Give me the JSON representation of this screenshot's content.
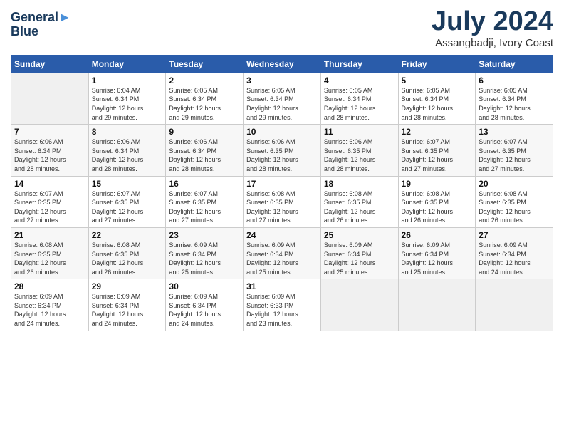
{
  "logo": {
    "line1": "General",
    "line2": "Blue"
  },
  "title": "July 2024",
  "subtitle": "Assangbadji, Ivory Coast",
  "days_of_week": [
    "Sunday",
    "Monday",
    "Tuesday",
    "Wednesday",
    "Thursday",
    "Friday",
    "Saturday"
  ],
  "weeks": [
    [
      {
        "num": "",
        "info": ""
      },
      {
        "num": "1",
        "info": "Sunrise: 6:04 AM\nSunset: 6:34 PM\nDaylight: 12 hours\nand 29 minutes."
      },
      {
        "num": "2",
        "info": "Sunrise: 6:05 AM\nSunset: 6:34 PM\nDaylight: 12 hours\nand 29 minutes."
      },
      {
        "num": "3",
        "info": "Sunrise: 6:05 AM\nSunset: 6:34 PM\nDaylight: 12 hours\nand 29 minutes."
      },
      {
        "num": "4",
        "info": "Sunrise: 6:05 AM\nSunset: 6:34 PM\nDaylight: 12 hours\nand 28 minutes."
      },
      {
        "num": "5",
        "info": "Sunrise: 6:05 AM\nSunset: 6:34 PM\nDaylight: 12 hours\nand 28 minutes."
      },
      {
        "num": "6",
        "info": "Sunrise: 6:05 AM\nSunset: 6:34 PM\nDaylight: 12 hours\nand 28 minutes."
      }
    ],
    [
      {
        "num": "7",
        "info": "Sunrise: 6:06 AM\nSunset: 6:34 PM\nDaylight: 12 hours\nand 28 minutes."
      },
      {
        "num": "8",
        "info": "Sunrise: 6:06 AM\nSunset: 6:34 PM\nDaylight: 12 hours\nand 28 minutes."
      },
      {
        "num": "9",
        "info": "Sunrise: 6:06 AM\nSunset: 6:34 PM\nDaylight: 12 hours\nand 28 minutes."
      },
      {
        "num": "10",
        "info": "Sunrise: 6:06 AM\nSunset: 6:35 PM\nDaylight: 12 hours\nand 28 minutes."
      },
      {
        "num": "11",
        "info": "Sunrise: 6:06 AM\nSunset: 6:35 PM\nDaylight: 12 hours\nand 28 minutes."
      },
      {
        "num": "12",
        "info": "Sunrise: 6:07 AM\nSunset: 6:35 PM\nDaylight: 12 hours\nand 27 minutes."
      },
      {
        "num": "13",
        "info": "Sunrise: 6:07 AM\nSunset: 6:35 PM\nDaylight: 12 hours\nand 27 minutes."
      }
    ],
    [
      {
        "num": "14",
        "info": "Sunrise: 6:07 AM\nSunset: 6:35 PM\nDaylight: 12 hours\nand 27 minutes."
      },
      {
        "num": "15",
        "info": "Sunrise: 6:07 AM\nSunset: 6:35 PM\nDaylight: 12 hours\nand 27 minutes."
      },
      {
        "num": "16",
        "info": "Sunrise: 6:07 AM\nSunset: 6:35 PM\nDaylight: 12 hours\nand 27 minutes."
      },
      {
        "num": "17",
        "info": "Sunrise: 6:08 AM\nSunset: 6:35 PM\nDaylight: 12 hours\nand 27 minutes."
      },
      {
        "num": "18",
        "info": "Sunrise: 6:08 AM\nSunset: 6:35 PM\nDaylight: 12 hours\nand 26 minutes."
      },
      {
        "num": "19",
        "info": "Sunrise: 6:08 AM\nSunset: 6:35 PM\nDaylight: 12 hours\nand 26 minutes."
      },
      {
        "num": "20",
        "info": "Sunrise: 6:08 AM\nSunset: 6:35 PM\nDaylight: 12 hours\nand 26 minutes."
      }
    ],
    [
      {
        "num": "21",
        "info": "Sunrise: 6:08 AM\nSunset: 6:35 PM\nDaylight: 12 hours\nand 26 minutes."
      },
      {
        "num": "22",
        "info": "Sunrise: 6:08 AM\nSunset: 6:35 PM\nDaylight: 12 hours\nand 26 minutes."
      },
      {
        "num": "23",
        "info": "Sunrise: 6:09 AM\nSunset: 6:34 PM\nDaylight: 12 hours\nand 25 minutes."
      },
      {
        "num": "24",
        "info": "Sunrise: 6:09 AM\nSunset: 6:34 PM\nDaylight: 12 hours\nand 25 minutes."
      },
      {
        "num": "25",
        "info": "Sunrise: 6:09 AM\nSunset: 6:34 PM\nDaylight: 12 hours\nand 25 minutes."
      },
      {
        "num": "26",
        "info": "Sunrise: 6:09 AM\nSunset: 6:34 PM\nDaylight: 12 hours\nand 25 minutes."
      },
      {
        "num": "27",
        "info": "Sunrise: 6:09 AM\nSunset: 6:34 PM\nDaylight: 12 hours\nand 24 minutes."
      }
    ],
    [
      {
        "num": "28",
        "info": "Sunrise: 6:09 AM\nSunset: 6:34 PM\nDaylight: 12 hours\nand 24 minutes."
      },
      {
        "num": "29",
        "info": "Sunrise: 6:09 AM\nSunset: 6:34 PM\nDaylight: 12 hours\nand 24 minutes."
      },
      {
        "num": "30",
        "info": "Sunrise: 6:09 AM\nSunset: 6:34 PM\nDaylight: 12 hours\nand 24 minutes."
      },
      {
        "num": "31",
        "info": "Sunrise: 6:09 AM\nSunset: 6:33 PM\nDaylight: 12 hours\nand 23 minutes."
      },
      {
        "num": "",
        "info": ""
      },
      {
        "num": "",
        "info": ""
      },
      {
        "num": "",
        "info": ""
      }
    ]
  ]
}
